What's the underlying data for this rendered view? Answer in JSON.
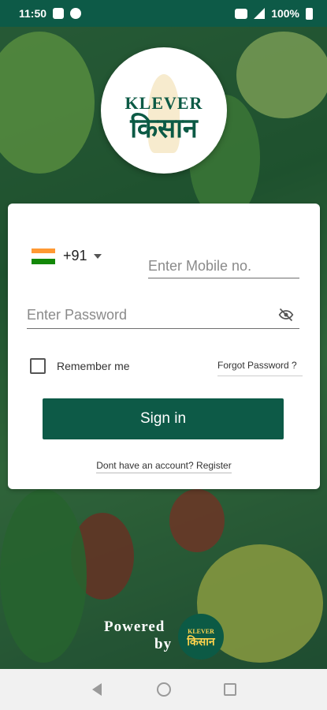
{
  "status_bar": {
    "time": "11:50",
    "battery": "100%"
  },
  "app": {
    "logo_line1": "KLEVER",
    "logo_line2": "किसान"
  },
  "login": {
    "country_code": "+91",
    "mobile_placeholder": "Enter Mobile no.",
    "password_placeholder": "Enter Password",
    "remember_me": "Remember me",
    "forgot_password": "Forgot Password ?",
    "sign_in": "Sign in",
    "register_text": "Dont have an account? Register"
  },
  "footer": {
    "powered_line1": "Powered",
    "powered_line2": "by",
    "logo_line1": "KLEVER",
    "logo_line2": "किसान"
  },
  "colors": {
    "brand": "#0d5a47",
    "flag_saffron": "#FF9933",
    "flag_white": "#FFFFFF",
    "flag_green": "#138808"
  },
  "icons": [
    "photo-icon",
    "notification-icon",
    "volte-icon",
    "signal-icon",
    "battery-icon",
    "india-flag-icon",
    "dropdown-caret-icon",
    "eye-off-icon",
    "checkbox-icon",
    "nav-back-icon",
    "nav-home-icon",
    "nav-recent-icon"
  ]
}
